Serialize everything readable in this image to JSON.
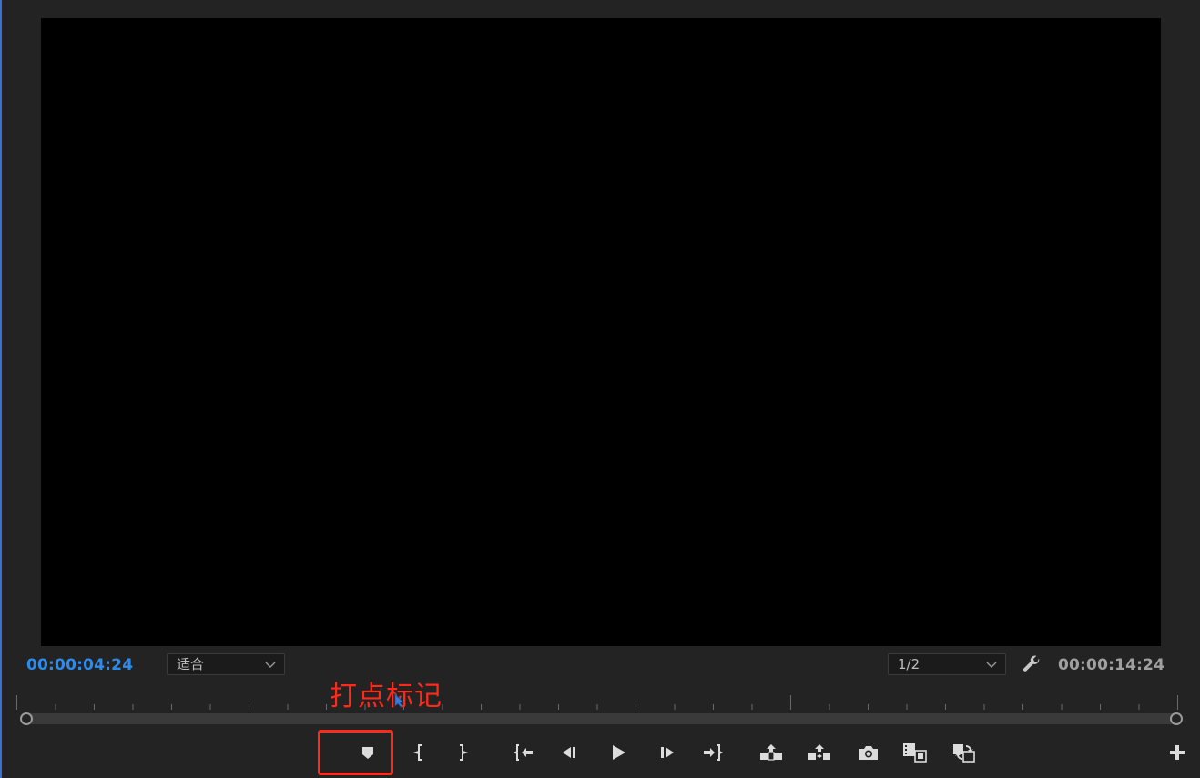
{
  "timecodes": {
    "current": "00:00:04:24",
    "duration": "00:00:14:24"
  },
  "zoom_select": {
    "value": "适合"
  },
  "resolution_select": {
    "value": "1/2"
  },
  "annotation": {
    "text": "打点标记"
  },
  "controls": {
    "icons": [
      "add-marker-icon",
      "mark-in-icon",
      "mark-out-icon",
      "go-to-in-icon",
      "step-back-icon",
      "play-icon",
      "step-forward-icon",
      "go-to-out-icon",
      "lift-icon",
      "extract-icon",
      "export-frame-icon",
      "insert-icon",
      "overwrite-icon",
      "button-editor-icon"
    ]
  },
  "colors": {
    "accent_timecode": "#2d8ceb",
    "annotation_red": "#ff2a1a",
    "panel_bg": "#232323",
    "viewer_bg": "#000000"
  }
}
